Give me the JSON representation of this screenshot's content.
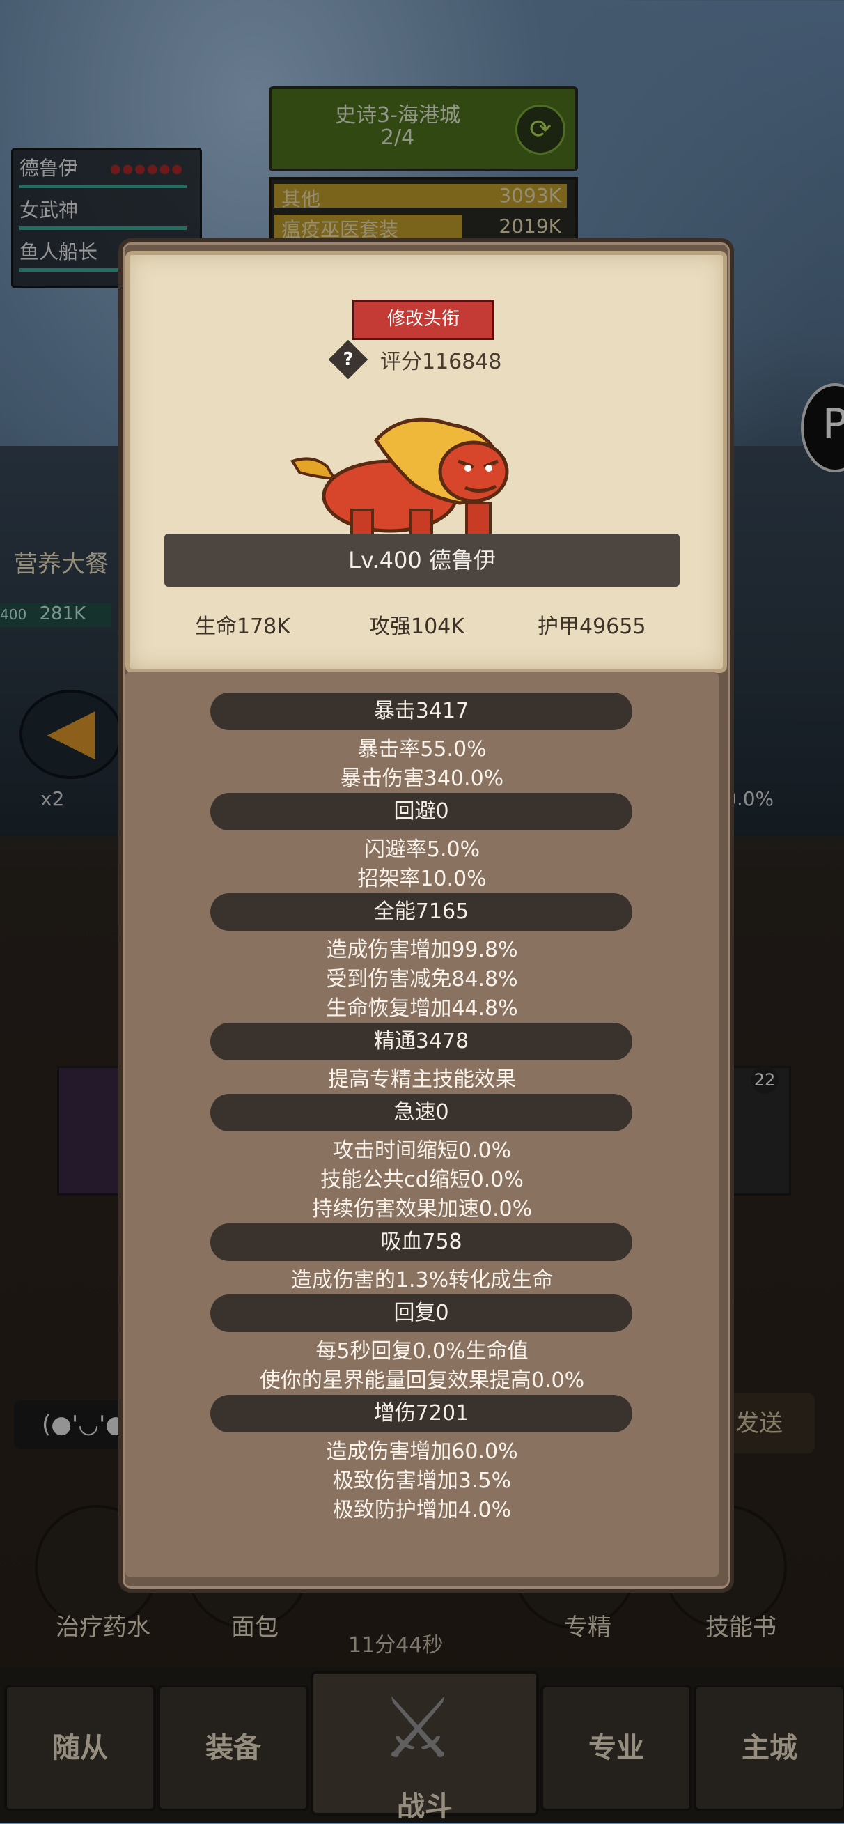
{
  "stage": {
    "title": "史诗3-海港城",
    "progress": "2/4"
  },
  "damage_list": [
    {
      "name": "其他",
      "value": "3093K"
    },
    {
      "name": "瘟疫巫医套装",
      "value": "2019K"
    }
  ],
  "team": [
    {
      "name": "德鲁伊"
    },
    {
      "name": "女武神"
    },
    {
      "name": "鱼人船长"
    }
  ],
  "background": {
    "food_label": "营养大餐",
    "food_level": "400",
    "food_hp": "281K",
    "speed": "x2",
    "right_percent": "0.0%",
    "card_badge": "22",
    "chat_emote": "(●'◡'●",
    "send_label": "发送",
    "timer": "11分44秒"
  },
  "items": [
    {
      "label": "治疗药水"
    },
    {
      "label": "面包"
    },
    {
      "label": "专精"
    },
    {
      "label": "技能书"
    }
  ],
  "nav": {
    "followers": "随从",
    "equipment": "装备",
    "battle": "战斗",
    "profession": "专业",
    "main_city": "主城"
  },
  "modal": {
    "change_title_button": "修改头衔",
    "score": "评分116848",
    "hero_name": "Lv.400 德鲁伊",
    "hp": "生命178K",
    "attack": "攻强104K",
    "armor": "护甲49655",
    "sections": [
      {
        "title": "暴击3417",
        "lines": [
          "暴击率55.0%",
          "暴击伤害340.0%"
        ]
      },
      {
        "title": "回避0",
        "lines": [
          "闪避率5.0%",
          "招架率10.0%"
        ]
      },
      {
        "title": "全能7165",
        "lines": [
          "造成伤害增加99.8%",
          "受到伤害减免84.8%",
          "生命恢复增加44.8%"
        ]
      },
      {
        "title": "精通3478",
        "lines": [
          "提高专精主技能效果"
        ]
      },
      {
        "title": "急速0",
        "lines": [
          "攻击时间缩短0.0%",
          "技能公共cd缩短0.0%",
          "持续伤害效果加速0.0%"
        ]
      },
      {
        "title": "吸血758",
        "lines": [
          "造成伤害的1.3%转化成生命"
        ]
      },
      {
        "title": "回复0",
        "lines": [
          "每5秒回复0.0%生命值",
          "使你的星界能量回复效果提高0.0%"
        ]
      },
      {
        "title": "增伤7201",
        "lines": [
          "造成伤害增加60.0%",
          "极致伤害增加3.5%",
          "极致防护增加4.0%"
        ]
      }
    ]
  }
}
